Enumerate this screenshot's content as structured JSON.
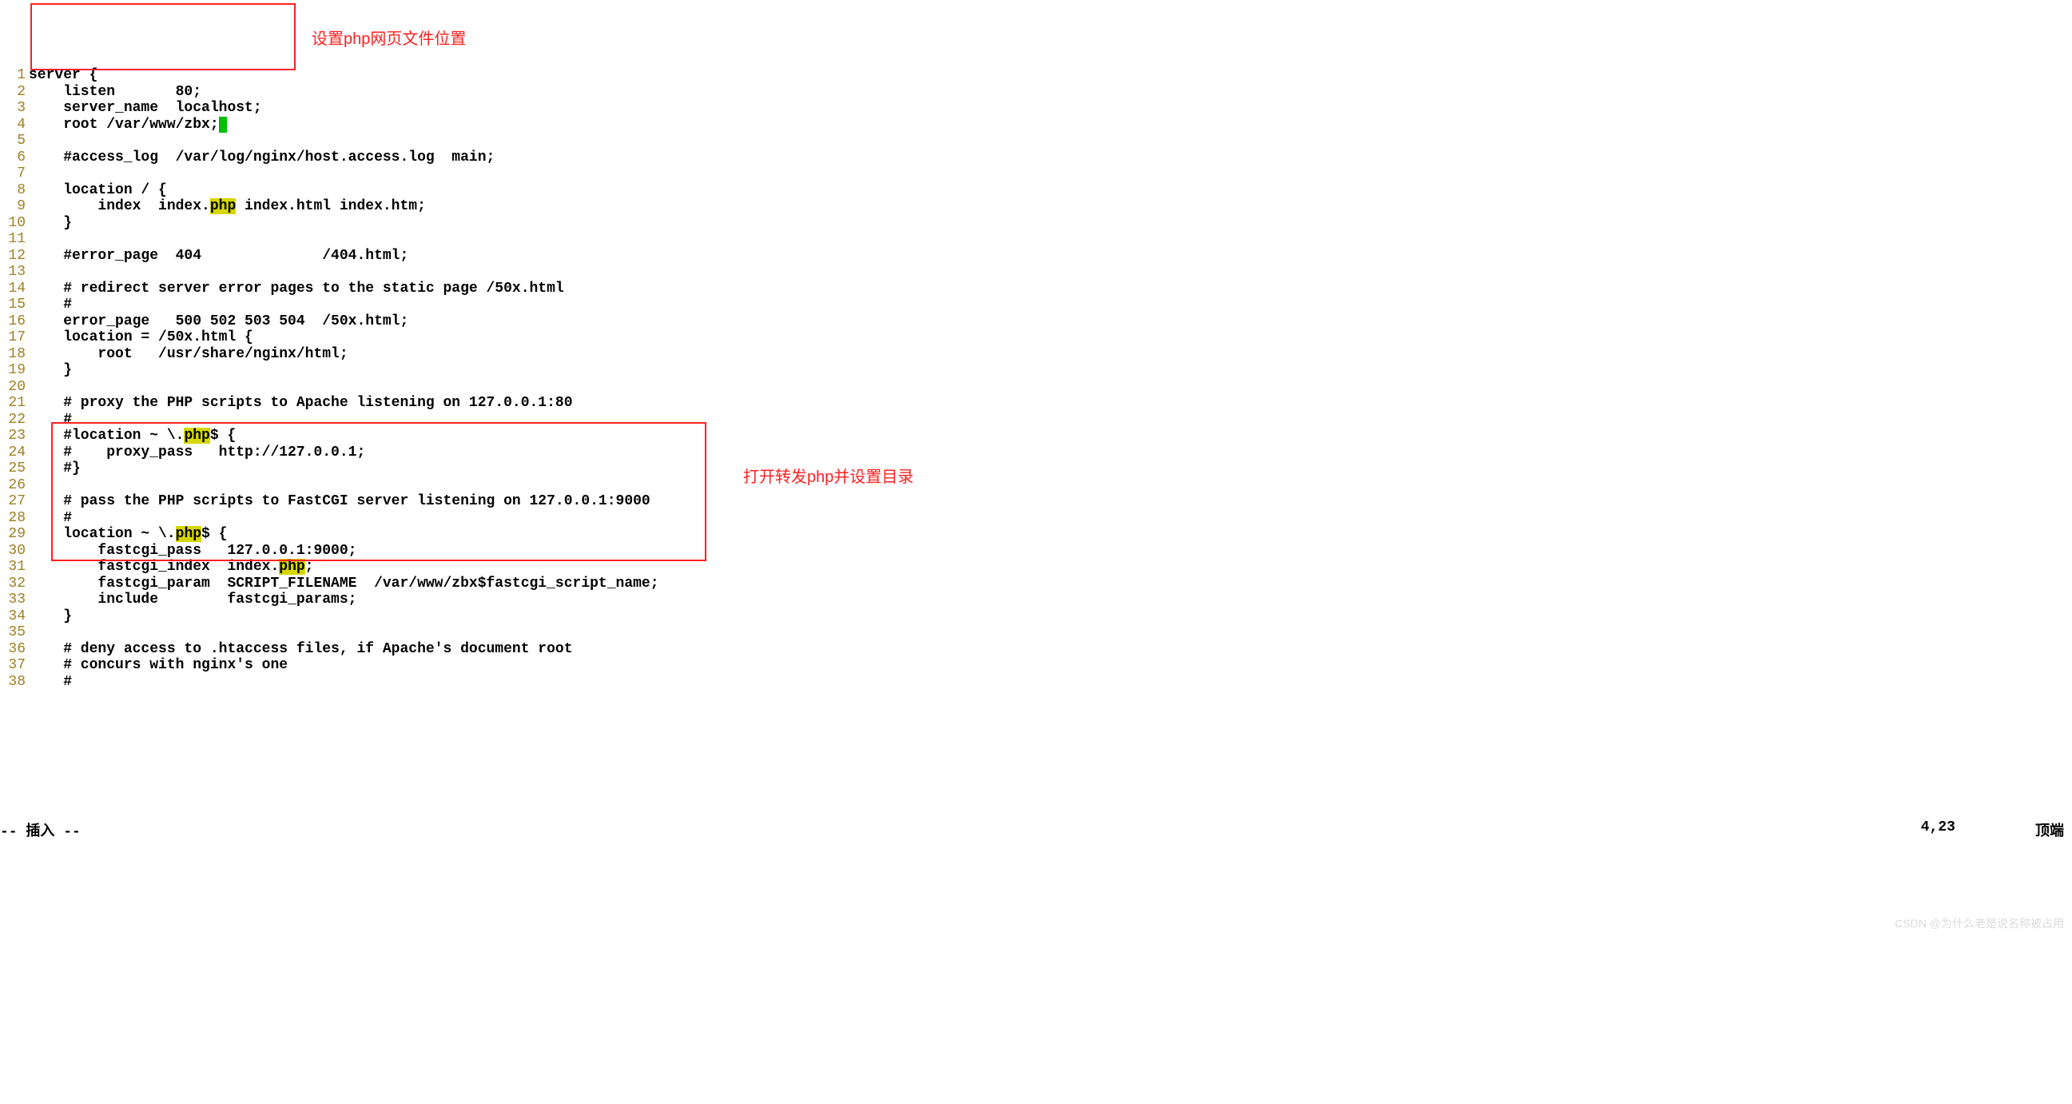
{
  "annotations": {
    "anno1": "设置php网页文件位置",
    "anno2": "打开转发php并设置目录"
  },
  "highlight_word": "php",
  "lines": [
    {
      "n": "1",
      "segments": [
        {
          "t": "server {"
        }
      ]
    },
    {
      "n": "2",
      "segments": [
        {
          "t": "    listen       80;"
        }
      ]
    },
    {
      "n": "3",
      "segments": [
        {
          "t": "    server_name  localhost;"
        }
      ]
    },
    {
      "n": "4",
      "segments": [
        {
          "t": "    root /var/www/zbx;"
        },
        {
          "t": " ",
          "cursor": true
        }
      ]
    },
    {
      "n": "5",
      "segments": [
        {
          "t": ""
        }
      ]
    },
    {
      "n": "6",
      "segments": [
        {
          "t": "    #access_log  /var/log/nginx/host.access.log  main;"
        }
      ]
    },
    {
      "n": "7",
      "segments": [
        {
          "t": ""
        }
      ]
    },
    {
      "n": "8",
      "segments": [
        {
          "t": "    location / {"
        }
      ]
    },
    {
      "n": "9",
      "segments": [
        {
          "t": "        index  index."
        },
        {
          "t": "php",
          "hl": true
        },
        {
          "t": " index.html index.htm;"
        }
      ]
    },
    {
      "n": "10",
      "segments": [
        {
          "t": "    }"
        }
      ]
    },
    {
      "n": "11",
      "segments": [
        {
          "t": ""
        }
      ]
    },
    {
      "n": "12",
      "segments": [
        {
          "t": "    #error_page  404              /404.html;"
        }
      ]
    },
    {
      "n": "13",
      "segments": [
        {
          "t": ""
        }
      ]
    },
    {
      "n": "14",
      "segments": [
        {
          "t": "    # redirect server error pages to the static page /50x.html"
        }
      ]
    },
    {
      "n": "15",
      "segments": [
        {
          "t": "    #"
        }
      ]
    },
    {
      "n": "16",
      "segments": [
        {
          "t": "    error_page   500 502 503 504  /50x.html;"
        }
      ]
    },
    {
      "n": "17",
      "segments": [
        {
          "t": "    location = /50x.html {"
        }
      ]
    },
    {
      "n": "18",
      "segments": [
        {
          "t": "        root   /usr/share/nginx/html;"
        }
      ]
    },
    {
      "n": "19",
      "segments": [
        {
          "t": "    }"
        }
      ]
    },
    {
      "n": "20",
      "segments": [
        {
          "t": ""
        }
      ]
    },
    {
      "n": "21",
      "segments": [
        {
          "t": "    # proxy the PHP scripts to Apache listening on 127.0.0.1:80"
        }
      ]
    },
    {
      "n": "22",
      "segments": [
        {
          "t": "    #"
        }
      ]
    },
    {
      "n": "23",
      "segments": [
        {
          "t": "    #location ~ \\."
        },
        {
          "t": "php",
          "hl": true
        },
        {
          "t": "$ {"
        }
      ]
    },
    {
      "n": "24",
      "segments": [
        {
          "t": "    #    proxy_pass   http://127.0.0.1;"
        }
      ]
    },
    {
      "n": "25",
      "segments": [
        {
          "t": "    #}"
        }
      ]
    },
    {
      "n": "26",
      "segments": [
        {
          "t": ""
        }
      ]
    },
    {
      "n": "27",
      "segments": [
        {
          "t": "    # pass the PHP scripts to FastCGI server listening on 127.0.0.1:9000"
        }
      ]
    },
    {
      "n": "28",
      "segments": [
        {
          "t": "    #"
        }
      ]
    },
    {
      "n": "29",
      "segments": [
        {
          "t": "    location ~ \\."
        },
        {
          "t": "php",
          "hl": true
        },
        {
          "t": "$ {"
        }
      ]
    },
    {
      "n": "30",
      "segments": [
        {
          "t": "        fastcgi_pass   127.0.0.1:9000;"
        }
      ]
    },
    {
      "n": "31",
      "segments": [
        {
          "t": "        fastcgi_index  index."
        },
        {
          "t": "php",
          "hl": true
        },
        {
          "t": ";"
        }
      ]
    },
    {
      "n": "32",
      "segments": [
        {
          "t": "        fastcgi_param  SCRIPT_FILENAME  /var/www/zbx$fastcgi_script_name;"
        }
      ]
    },
    {
      "n": "33",
      "segments": [
        {
          "t": "        include        fastcgi_params;"
        }
      ]
    },
    {
      "n": "34",
      "segments": [
        {
          "t": "    }"
        }
      ]
    },
    {
      "n": "35",
      "segments": [
        {
          "t": ""
        }
      ]
    },
    {
      "n": "36",
      "segments": [
        {
          "t": "    # deny access to .htaccess files, if Apache's document root"
        }
      ]
    },
    {
      "n": "37",
      "segments": [
        {
          "t": "    # concurs with nginx's one"
        }
      ]
    },
    {
      "n": "38",
      "segments": [
        {
          "t": "    #"
        }
      ]
    }
  ],
  "status": {
    "mode": "-- 插入 --",
    "position": "4,23",
    "scroll": "顶端"
  },
  "watermark": "CSDN @为什么老是说名称被占用"
}
